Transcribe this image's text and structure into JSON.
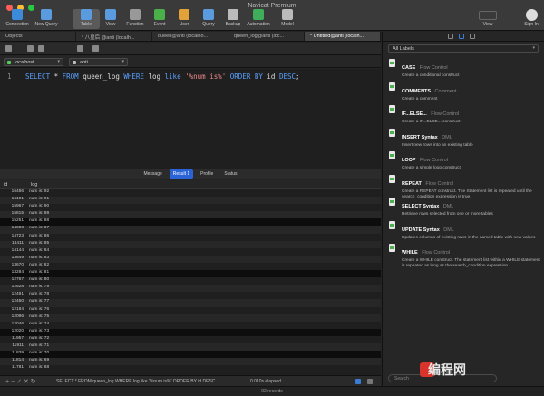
{
  "window": {
    "title": "Navicat Premium"
  },
  "toolbar": {
    "items": [
      {
        "label": "Connection",
        "color": "#3d8bd8"
      },
      {
        "label": "New Query",
        "color": "#5a9be0"
      },
      {
        "label": "Table",
        "color": "#5a9be0"
      },
      {
        "label": "View",
        "color": "#5a9be0"
      },
      {
        "label": "Function",
        "color": "#999999"
      },
      {
        "label": "Event",
        "color": "#49b04a"
      },
      {
        "label": "User",
        "color": "#e3a13a"
      },
      {
        "label": "Query",
        "color": "#5a9be0"
      },
      {
        "label": "Backup",
        "color": "#bbbbbb"
      },
      {
        "label": "Automation",
        "color": "#3fae5a"
      },
      {
        "label": "Model",
        "color": "#bbbbbb"
      }
    ],
    "view_label": "View",
    "signin_label": "Sign In"
  },
  "tabs": [
    "Objects",
    "* 八皇后 @anti (localh...",
    "queen@anti (localho...",
    "queen_log@anti (loc...",
    "* Untitled@anti (localh..."
  ],
  "selectors": {
    "connection": "localhost",
    "database": "anti"
  },
  "editor": {
    "line": "1",
    "kw1": "SELECT",
    "star": " * ",
    "kw2": "FROM",
    "table": " queen_log ",
    "kw3": "WHERE",
    "col": " log ",
    "kw4": "like",
    "pattern": " '%num is%' ",
    "kw5": "ORDER BY",
    "tail": " id ",
    "kw6": "DESC",
    "end": ";"
  },
  "result_tabs": [
    "Message",
    "Result 1",
    "Profile",
    "Status"
  ],
  "grid": {
    "headers": [
      "id",
      "log"
    ],
    "rows": [
      [
        "16486",
        "num is: 92"
      ],
      [
        "16191",
        "num is: 91"
      ],
      [
        "15967",
        "num is: 90"
      ],
      [
        "15815",
        "num is: 89"
      ],
      [
        "15251",
        "num is: 88"
      ],
      [
        "14603",
        "num is: 87"
      ],
      [
        "14723",
        "num is: 86"
      ],
      [
        "14411",
        "num is: 85"
      ],
      [
        "14144",
        "num is: 84"
      ],
      [
        "13849",
        "num is: 83"
      ],
      [
        "13670",
        "num is: 82"
      ],
      [
        "13284",
        "num is: 81"
      ],
      [
        "12767",
        "num is: 80"
      ],
      [
        "12528",
        "num is: 79"
      ],
      [
        "12491",
        "num is: 78"
      ],
      [
        "12450",
        "num is: 77"
      ],
      [
        "12184",
        "num is: 76"
      ],
      [
        "12096",
        "num is: 75"
      ],
      [
        "12046",
        "num is: 74"
      ],
      [
        "12020",
        "num is: 73"
      ],
      [
        "11957",
        "num is: 72"
      ],
      [
        "11911",
        "num is: 71"
      ],
      [
        "11839",
        "num is: 70"
      ],
      [
        "11814",
        "num is: 69"
      ],
      [
        "11781",
        "num is: 68"
      ]
    ]
  },
  "status": {
    "query": "SELECT * FROM queen_log WHERE log like '%num is%' ORDER BY id DESC",
    "elapsed": "0.010s elapsed",
    "records": "92 records"
  },
  "snippets": {
    "filter": "All Labels",
    "items": [
      {
        "name": "CASE",
        "category": "Flow Control",
        "desc": "Create a conditional construct"
      },
      {
        "name": "COMMENTS",
        "category": "Comment",
        "desc": "Create a comment"
      },
      {
        "name": "IF...ELSE...",
        "category": "Flow Control",
        "desc": "Create a IF...ELSE... construct"
      },
      {
        "name": "INSERT Syntax",
        "category": "DML",
        "desc": "Insert new rows into an existing table"
      },
      {
        "name": "LOOP",
        "category": "Flow Control",
        "desc": "Create a simple loop construct"
      },
      {
        "name": "REPEAT",
        "category": "Flow Control",
        "desc": "Create a REPEAT construct. The Statement list is repeated until the search_condition expression is true."
      },
      {
        "name": "SELECT Syntax",
        "category": "DML",
        "desc": "Retrieve rows selected from one or more tables"
      },
      {
        "name": "UPDATE Syntax",
        "category": "DML",
        "desc": "Updates columns of existing rows in the named table with new values"
      },
      {
        "name": "WHILE",
        "category": "Flow Control",
        "desc": "Create a WHILE construct. The statement list within a WHILE statement is repeated as long as the search_condition expression..."
      }
    ],
    "search_placeholder": "Search"
  },
  "watermark": "编程网"
}
